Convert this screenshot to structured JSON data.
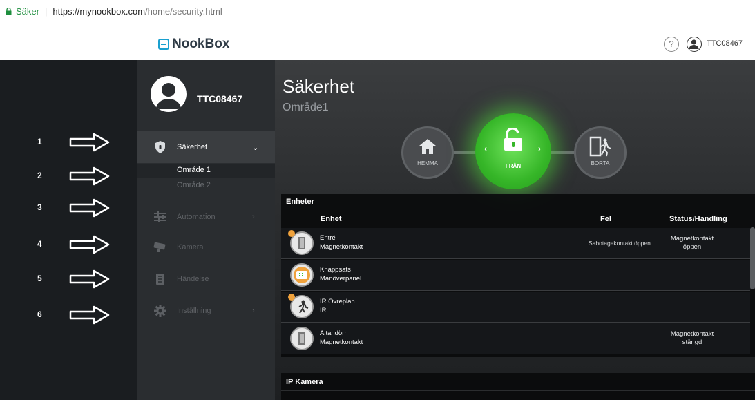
{
  "browser": {
    "secure_label": "Säker",
    "separator": "|",
    "url_domain": "https://mynookbox.com",
    "url_path": "/home/security.html"
  },
  "header": {
    "logo_text": "NookBox",
    "help_label": "?",
    "username": "TTC08467"
  },
  "annotations": [
    "1",
    "2",
    "3",
    "4",
    "5",
    "6"
  ],
  "sidebar": {
    "profile_name": "TTC08467",
    "items": [
      {
        "label": "Säkerhet",
        "chevron": "⌄",
        "icon": "shield-icon",
        "active": true
      },
      {
        "label": "Automation",
        "chevron": "›",
        "icon": "sliders-icon",
        "active": false
      },
      {
        "label": "Kamera",
        "chevron": "",
        "icon": "camera-icon",
        "active": false
      },
      {
        "label": "Händelse",
        "chevron": "",
        "icon": "event-log-icon",
        "active": false
      },
      {
        "label": "Inställning",
        "chevron": "›",
        "icon": "gear-icon",
        "active": false
      }
    ],
    "subitems": [
      {
        "label": "Område 1",
        "active": true
      },
      {
        "label": "Område 2",
        "active": false
      }
    ]
  },
  "main": {
    "title": "Säkerhet",
    "subtitle": "Område1",
    "modes": [
      {
        "label": "HEMMA",
        "icon": "home-icon"
      },
      {
        "label": "FRÅN",
        "icon": "unlock-icon",
        "selected": true
      },
      {
        "label": "BORTA",
        "icon": "away-door-icon"
      }
    ],
    "devices": {
      "title": "Enheter",
      "columns": [
        "Enhet",
        "Fel",
        "Status/Handling"
      ],
      "rows": [
        {
          "name": "Entré",
          "type": "Magnetkontakt",
          "fault": "Sabotagekontakt öppen",
          "status": [
            "Magnetkontakt",
            "öppen"
          ],
          "icon": "door-contact-icon",
          "alert": true
        },
        {
          "name": "Knappsats",
          "type": "Manöverpanel",
          "fault": "",
          "status": [
            "",
            ""
          ],
          "icon": "keypad-icon",
          "alert": false
        },
        {
          "name": "IR Övreplan",
          "type": "IR",
          "fault": "",
          "status": [
            "",
            ""
          ],
          "icon": "motion-sensor-icon",
          "alert": true
        },
        {
          "name": "Altandörr",
          "type": "Magnetkontakt",
          "fault": "",
          "status": [
            "Magnetkontakt",
            "stängd"
          ],
          "icon": "door-contact-icon",
          "alert": false
        }
      ]
    },
    "camera_panel_title": "IP Kamera"
  },
  "colors": {
    "accent_green": "#3fc22f",
    "logo_blue": "#1aa0cf",
    "sidebar_bg": "#2a2d30",
    "alert_orange": "#f0a23c"
  }
}
